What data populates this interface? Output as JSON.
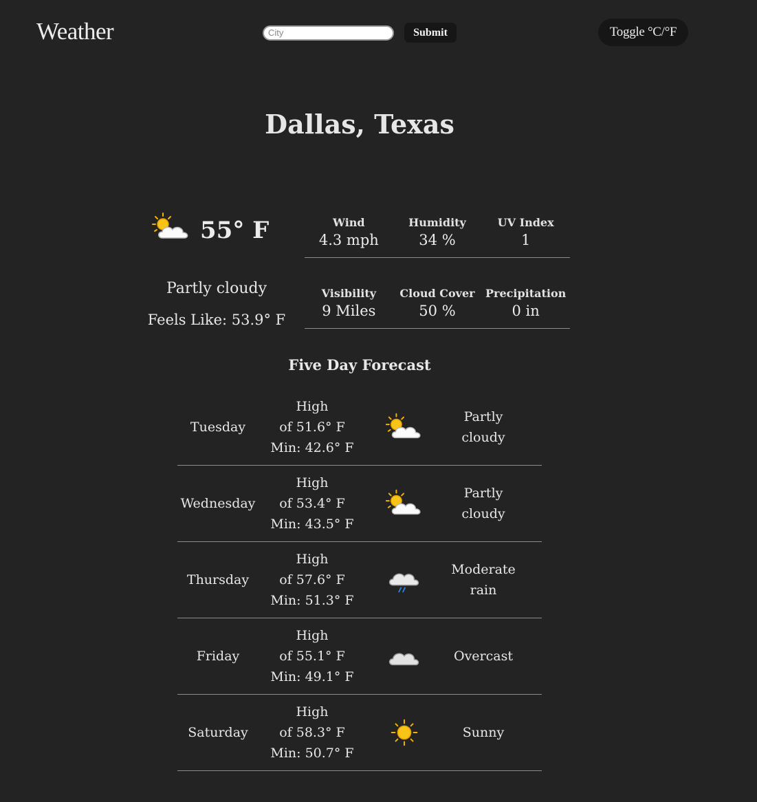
{
  "header": {
    "logo": "Weather",
    "search_placeholder": "City",
    "search_value": "",
    "submit_label": "Submit",
    "toggle_label": "Toggle °C/°F"
  },
  "location": {
    "name": "Dallas, Texas"
  },
  "current": {
    "icon": "partly-cloudy-icon",
    "temperature": "55° F",
    "condition": "Partly cloudy",
    "feels_like": "Feels Like: 53.9° F",
    "stats": [
      [
        {
          "label": "Wind",
          "value": "4.3 mph"
        },
        {
          "label": "Humidity",
          "value": "34 %"
        },
        {
          "label": "UV Index",
          "value": "1"
        }
      ],
      [
        {
          "label": "Visibility",
          "value": "9 Miles"
        },
        {
          "label": "Cloud Cover",
          "value": "50 %"
        },
        {
          "label": "Precipitation",
          "value": "0 in"
        }
      ]
    ]
  },
  "forecast": {
    "title": "Five Day Forecast",
    "days": [
      {
        "day": "Tuesday",
        "high_prefix": "High",
        "high": "of 51.6° F",
        "min": "Min: 42.6° F",
        "icon": "partly-cloudy-icon",
        "condition_lines": [
          "Partly",
          "cloudy"
        ]
      },
      {
        "day": "Wednesday",
        "high_prefix": "High",
        "high": "of 53.4° F",
        "min": "Min: 43.5° F",
        "icon": "partly-cloudy-icon",
        "condition_lines": [
          "Partly",
          "cloudy"
        ]
      },
      {
        "day": "Thursday",
        "high_prefix": "High",
        "high": "of 57.6° F",
        "min": "Min: 51.3° F",
        "icon": "rain-cloud-icon",
        "condition_lines": [
          "Moderate",
          "rain"
        ]
      },
      {
        "day": "Friday",
        "high_prefix": "High",
        "high": "of 55.1° F",
        "min": "Min: 49.1° F",
        "icon": "overcast-cloud-icon",
        "condition_lines": [
          "Overcast"
        ]
      },
      {
        "day": "Saturday",
        "high_prefix": "High",
        "high": "of 58.3° F",
        "min": "Min: 50.7° F",
        "icon": "sun-icon",
        "condition_lines": [
          "Sunny"
        ]
      }
    ]
  },
  "colors": {
    "background": "#232323",
    "text": "#e8e8e8",
    "button_bg": "#161616",
    "divider": "#8c8c8c",
    "sun": "#f5b400",
    "rain": "#2f7fd8"
  }
}
